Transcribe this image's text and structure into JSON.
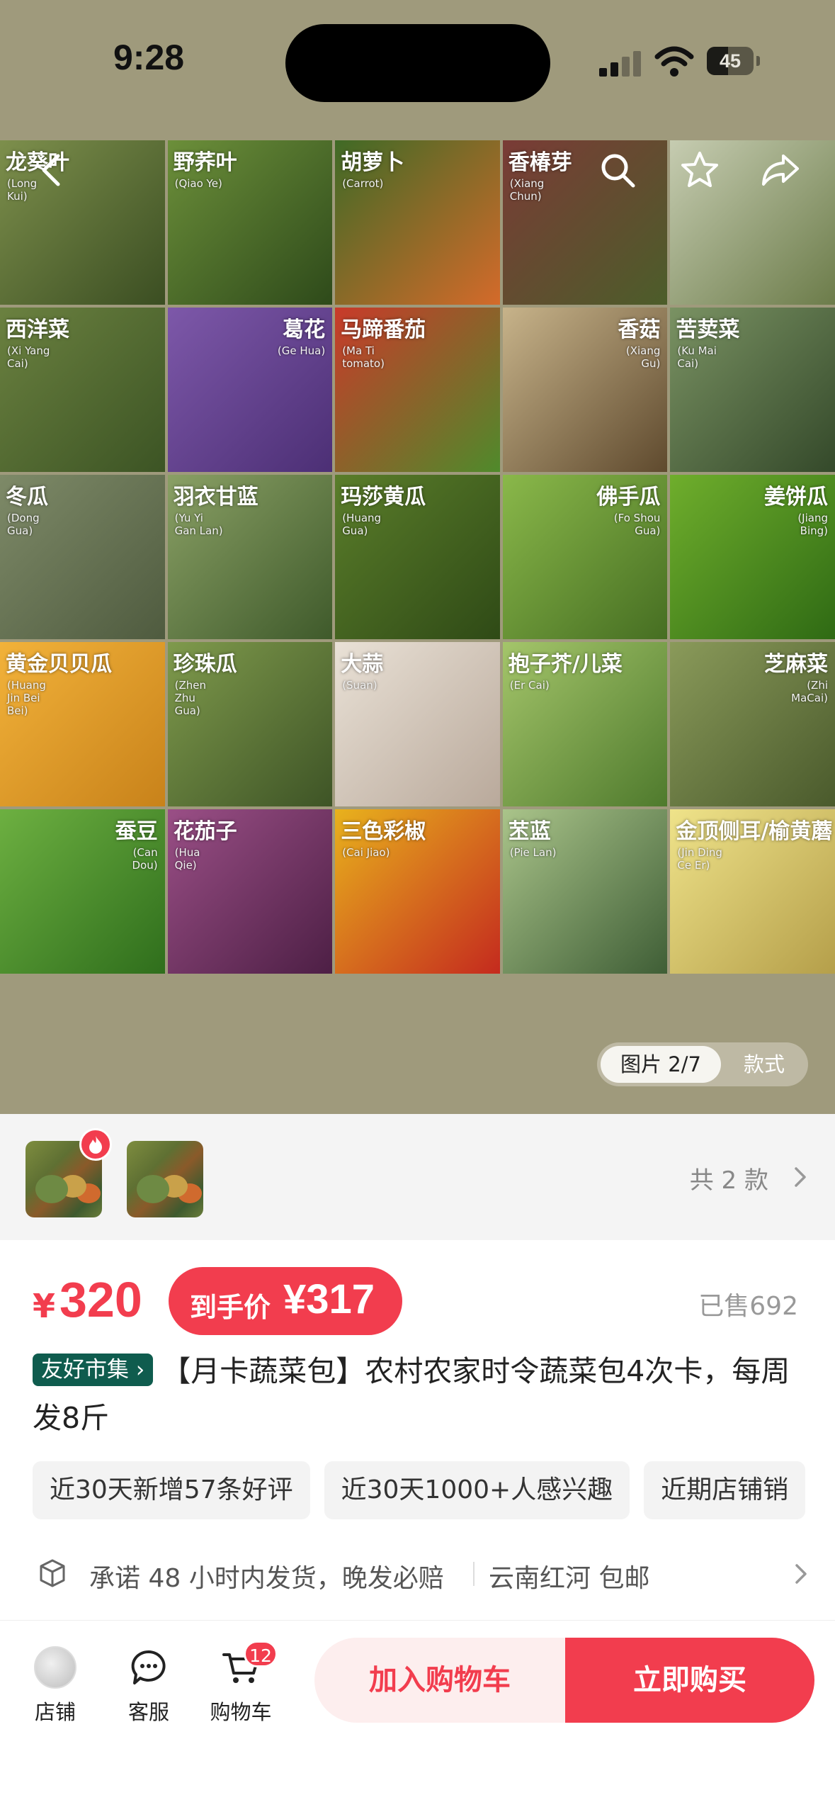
{
  "status": {
    "time": "9:28",
    "battery": "45",
    "battery_level": 0.45
  },
  "gallery": {
    "tiles": [
      {
        "name": "龙葵叶",
        "pinyin": "(Long Kui)",
        "bg": [
          "#7d8f4c",
          "#3b4e22"
        ],
        "align": "left"
      },
      {
        "name": "野荞叶",
        "pinyin": "(Qiao Ye)",
        "bg": [
          "#6c8f3a",
          "#2e4a1a"
        ],
        "align": "left"
      },
      {
        "name": "胡萝卜",
        "pinyin": "(Carrot)",
        "bg": [
          "#3f6a26",
          "#d46a2a"
        ],
        "align": "left"
      },
      {
        "name": "香椿芽",
        "pinyin": "(Xiang Chun)",
        "bg": [
          "#7a3b36",
          "#4c5d2a"
        ],
        "align": "left"
      },
      {
        "name": "",
        "pinyin": "",
        "bg": [
          "#c6ccb1",
          "#6c7c4a"
        ],
        "align": "left"
      },
      {
        "name": "西洋菜",
        "pinyin": "(Xi Yang Cai)",
        "bg": [
          "#6b8140",
          "#3c5424"
        ],
        "align": "left"
      },
      {
        "name": "葛花",
        "pinyin": "(Ge Hua)",
        "bg": [
          "#7d58a9",
          "#4c2f75"
        ],
        "align": "right"
      },
      {
        "name": "马蹄番茄",
        "pinyin": "(Ma Ti tomato)",
        "bg": [
          "#c93a2a",
          "#4f8a2b"
        ],
        "align": "left"
      },
      {
        "name": "香菇",
        "pinyin": "(Xiang Gu)",
        "bg": [
          "#c7b38a",
          "#5f4a2e"
        ],
        "align": "right"
      },
      {
        "name": "苦荬菜",
        "pinyin": "(Ku Mai Cai)",
        "bg": [
          "#7a9263",
          "#34492a"
        ],
        "align": "left"
      },
      {
        "name": "冬瓜",
        "pinyin": "(Dong Gua)",
        "bg": [
          "#7e8a68",
          "#4f5b3f"
        ],
        "align": "left"
      },
      {
        "name": "羽衣甘蓝",
        "pinyin": "(Yu Yi Gan Lan)",
        "bg": [
          "#8aa065",
          "#3f5a2b"
        ],
        "align": "left"
      },
      {
        "name": "玛莎黄瓜",
        "pinyin": "(Huang Gua)",
        "bg": [
          "#5a7d2a",
          "#2f4a16"
        ],
        "align": "left"
      },
      {
        "name": "佛手瓜",
        "pinyin": "(Fo Shou Gua)",
        "bg": [
          "#8ab84a",
          "#466e22"
        ],
        "align": "right"
      },
      {
        "name": "姜饼瓜",
        "pinyin": "(Jiang Bing)",
        "bg": [
          "#6fae2c",
          "#2f6a14"
        ],
        "align": "right"
      },
      {
        "name": "黄金贝贝瓜",
        "pinyin": "(Huang Jin Bei Bei)",
        "bg": [
          "#f2b23a",
          "#c8821a"
        ],
        "align": "left"
      },
      {
        "name": "珍珠瓜",
        "pinyin": "(Zhen Zhu Gua)",
        "bg": [
          "#7f9a4c",
          "#3e5426"
        ],
        "align": "left"
      },
      {
        "name": "大蒜",
        "pinyin": "(Suan)",
        "bg": [
          "#e9e1d6",
          "#b9a99b"
        ],
        "align": "left"
      },
      {
        "name": "抱子芥/儿菜",
        "pinyin": "(Er Cai)",
        "bg": [
          "#a4c56a",
          "#4f7a2d"
        ],
        "align": "left"
      },
      {
        "name": "芝麻菜",
        "pinyin": "(Zhi MaCai)",
        "bg": [
          "#8a9a5a",
          "#4a5a2c"
        ],
        "align": "right"
      },
      {
        "name": "蚕豆",
        "pinyin": "(Can Dou)",
        "bg": [
          "#6db041",
          "#2f6e1c"
        ],
        "align": "right"
      },
      {
        "name": "花茄子",
        "pinyin": "(Hua Qie)",
        "bg": [
          "#9a4f86",
          "#4d1f45"
        ],
        "align": "left"
      },
      {
        "name": "三色彩椒",
        "pinyin": "(Cai Jiao)",
        "bg": [
          "#e8b21d",
          "#c42a1e"
        ],
        "align": "left"
      },
      {
        "name": "苤蓝",
        "pinyin": "(Pie Lan)",
        "bg": [
          "#aac48a",
          "#3f5e36"
        ],
        "align": "left"
      },
      {
        "name": "金顶侧耳/榆黄蘑",
        "pinyin": "(Jin Ding Ce Er)",
        "bg": [
          "#efe38a",
          "#b59f4a"
        ],
        "align": "left"
      }
    ],
    "counter": "图片 2/7",
    "style_tab": "款式"
  },
  "variants": {
    "count_label": "共 2 款"
  },
  "price": {
    "currency": "¥",
    "value": "320",
    "final_label": "到手价",
    "final_value": "¥317",
    "sold": "已售692"
  },
  "product": {
    "tag": "友好市集 ›",
    "title": "【月卡蔬菜包】农村农家时令蔬菜包4次卡，每周发8斤"
  },
  "chips": [
    "近30天新增57条好评",
    "近30天1000+人感兴趣",
    "近期店铺销"
  ],
  "promise": {
    "text": "承诺 48 小时内发货，晚发必赔",
    "ship": "云南红河 包邮"
  },
  "bottom": {
    "shop": "店铺",
    "service": "客服",
    "cart": "购物车",
    "cart_count": "12",
    "add_to_cart": "加入购物车",
    "buy_now": "立即购买"
  },
  "colors": {
    "accent": "#f23d4e",
    "hero_bg": "#9f9a7c",
    "tag_bg": "#0f5c4e"
  }
}
